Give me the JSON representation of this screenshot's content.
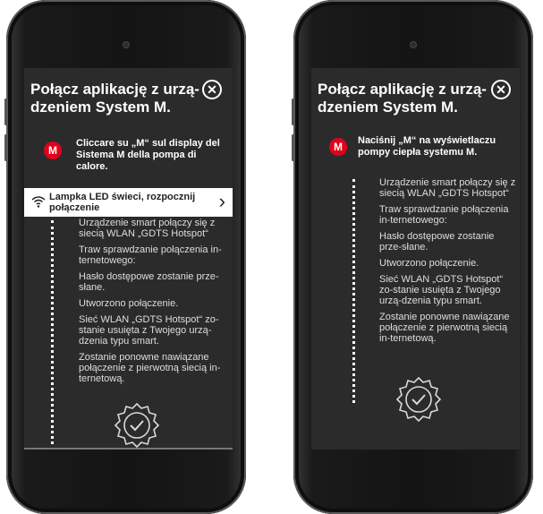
{
  "left_screen": {
    "title": "Połącz aplikację z urzą-dzeniem System M.",
    "close_label": "✕",
    "step_badge": "M",
    "step_text": "Cliccare su „M“ sul display del Sistema M della pompa di calore.",
    "band_label": "Lampka LED świeci, rozpocznij połączenie",
    "band_chevron": "›",
    "body": [
      "Urządzenie smart połączy się z siecią WLAN „GDTS Hotspot“",
      "Traw sprawdzanie połączenia in-ternetowego:",
      "Hasło dostępowe zostanie prze-słane.",
      "Utworzono połączenie.",
      "Sieć WLAN „GDTS Hotspot“ zo-stanie usuięta z Twojego urzą-dzenia typu smart.",
      "Zostanie ponowne nawiązane połączenie z pierwotną siecią in-ternetową."
    ]
  },
  "right_screen": {
    "title": "Połącz aplikację z urzą-dzeniem System M.",
    "close_label": "✕",
    "step_badge": "M",
    "step_text": "Naciśnij „M“ na wyświetlaczu pompy ciepła systemu M.",
    "body": [
      "Urządzenie smart połączy się z siecią WLAN „GDTS Hotspot“",
      "Traw sprawdzanie połączenia in-ternetowego:",
      "Hasło dostępowe zostanie prze-słane.",
      "Utworzono połączenie.",
      "Sieć WLAN „GDTS Hotspot“ zo-stanie usuięta z Twojego urzą-dzenia typu smart.",
      "Zostanie ponowne nawiązane połączenie z pierwotną siecią in-ternetową."
    ]
  },
  "colors": {
    "accent": "#e3001b",
    "screen_bg": "#2b2b2b",
    "text": "#ffffff"
  },
  "icons": {
    "close": "close-icon",
    "wifi": "wifi-icon",
    "chevron": "chevron-right-icon",
    "success": "check-badge-icon"
  }
}
